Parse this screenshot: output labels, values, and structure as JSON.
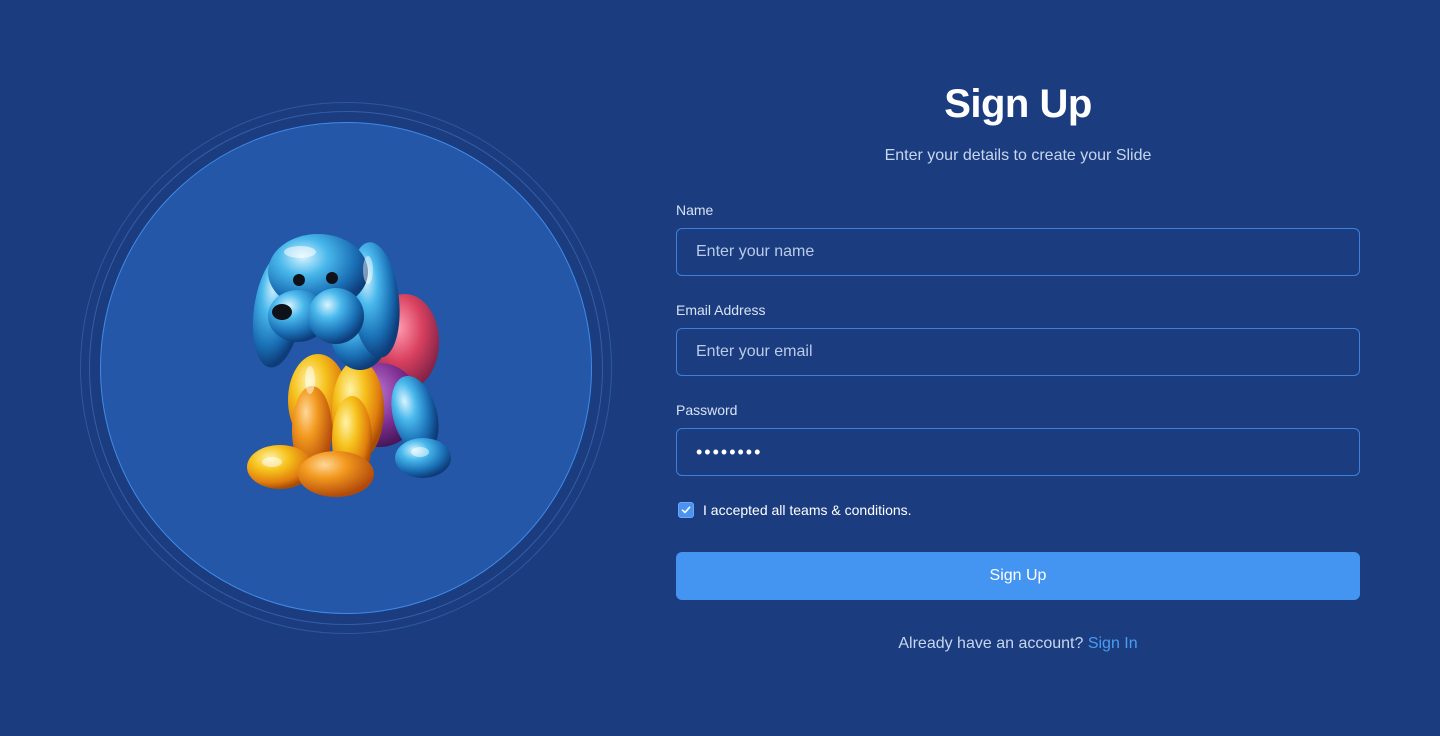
{
  "colors": {
    "background": "#1b3d7f",
    "circle_fill": "#2557a8",
    "accent": "#4494f2",
    "input_border": "#3d7fdc",
    "link": "#4a9bf2"
  },
  "hero": {
    "image": "balloon-dog-sculpture"
  },
  "form": {
    "title": "Sign Up",
    "subtitle": "Enter your details to create your Slide",
    "name": {
      "label": "Name",
      "placeholder": "Enter your name",
      "value": ""
    },
    "email": {
      "label": "Email Address",
      "placeholder": "Enter your email",
      "value": ""
    },
    "password": {
      "label": "Password",
      "value": "password"
    },
    "terms": {
      "checked": true,
      "label": "I accepted all teams & conditions."
    },
    "submit_label": "Sign Up",
    "footer": {
      "prompt": "Already have an account?",
      "link_label": "Sign In"
    }
  }
}
